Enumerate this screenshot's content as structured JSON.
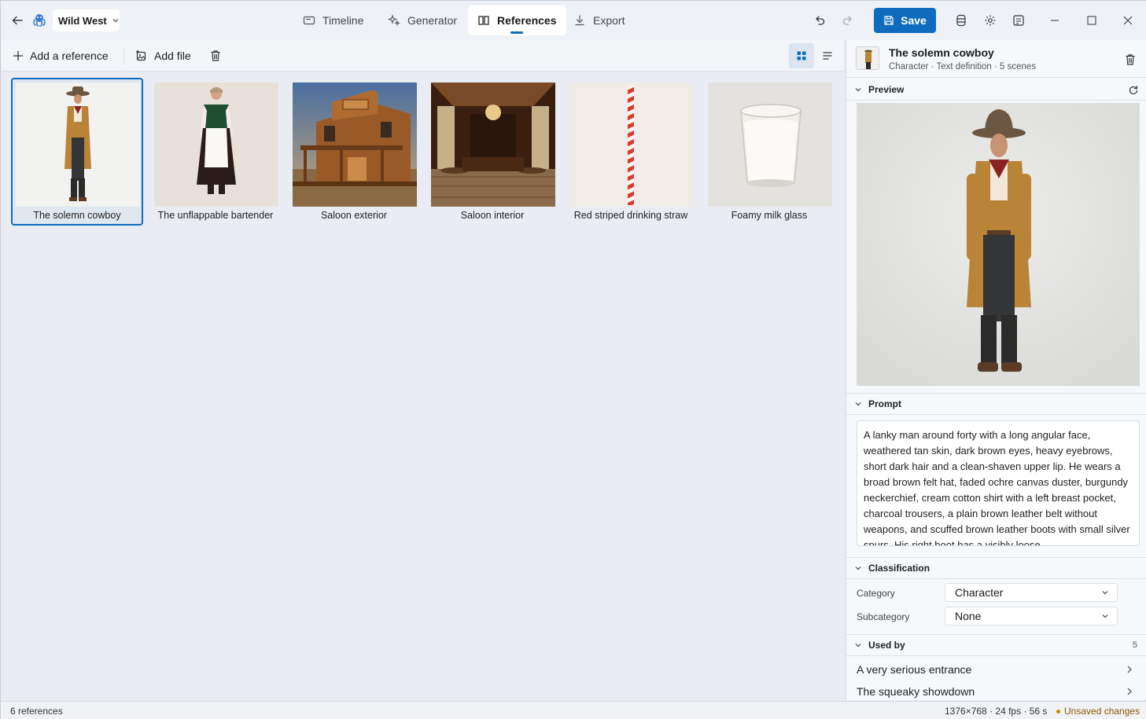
{
  "project": {
    "name": "Wild West"
  },
  "nav": {
    "tabs": [
      {
        "label": "Timeline",
        "icon": "timeline-icon"
      },
      {
        "label": "Generator",
        "icon": "sparkle-icon"
      },
      {
        "label": "References",
        "icon": "book-icon",
        "active": true
      },
      {
        "label": "Export",
        "icon": "download-icon"
      }
    ],
    "save_label": "Save"
  },
  "toolbar": {
    "add_reference": "Add a reference",
    "add_file": "Add file"
  },
  "references": [
    {
      "label": "The solemn cowboy",
      "selected": true
    },
    {
      "label": "The unflappable bartender"
    },
    {
      "label": "Saloon exterior"
    },
    {
      "label": "Saloon interior"
    },
    {
      "label": "Red striped drinking straw"
    },
    {
      "label": "Foamy milk glass"
    }
  ],
  "detail": {
    "title": "The solemn cowboy",
    "subtitle": "Character · Text definition · 5 scenes",
    "preview_label": "Preview",
    "prompt_label": "Prompt",
    "prompt_text": "A lanky man around forty with a long angular face, weathered tan skin, dark brown eyes, heavy eyebrows, short dark hair and a clean-shaven upper lip. He wears a broad brown felt hat, faded ochre canvas duster, burgundy neckerchief, cream cotton shirt with a left breast pocket, charcoal trousers, a plain brown leather belt without weapons, and scuffed brown leather boots with small silver spurs. His right boot has a visibly loose",
    "classification_label": "Classification",
    "category_label": "Category",
    "category_value": "Character",
    "subcategory_label": "Subcategory",
    "subcategory_value": "None",
    "used_by_label": "Used by",
    "used_by_count": "5",
    "used_by": [
      "A very serious entrance",
      "The squeaky showdown"
    ]
  },
  "status": {
    "count": "6 references",
    "info": "1376×768 · 24 fps · 56 s",
    "unsaved": "Unsaved changes"
  },
  "colors": {
    "accent": "#0f6cbd",
    "unsaved": "#c88a00"
  }
}
